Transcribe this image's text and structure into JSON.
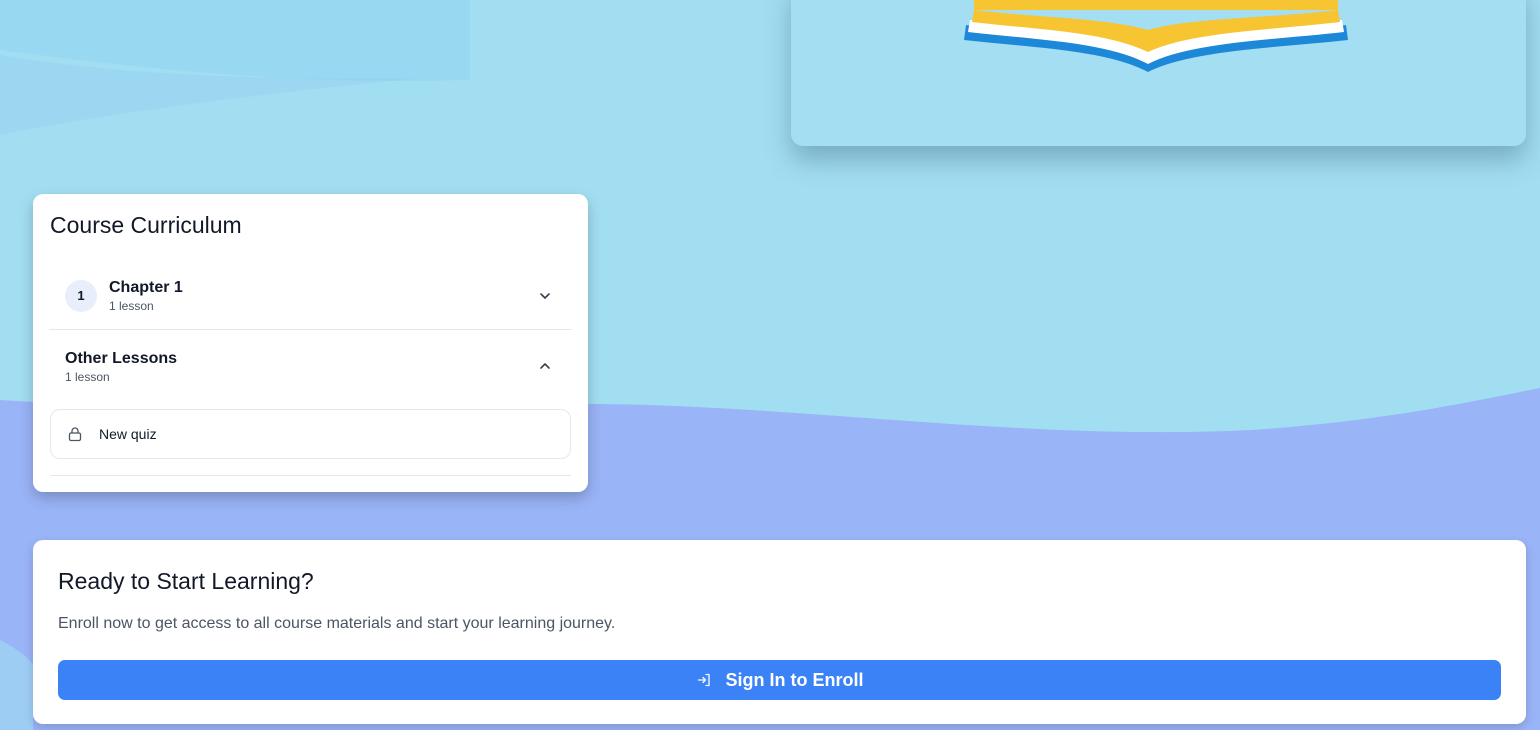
{
  "colors": {
    "sky": "#a2def2",
    "wave": "#9ab4f8",
    "primary": "#3b82f6",
    "card": "#ffffff"
  },
  "hero": {
    "image_icon": "book-logo-illustration"
  },
  "curriculum": {
    "title": "Course Curriculum",
    "sections": [
      {
        "number": "1",
        "name": "Chapter 1",
        "count": "1 lesson",
        "expanded": false,
        "icon": "chevron-down-icon"
      },
      {
        "number": "",
        "name": "Other Lessons",
        "count": "1 lesson",
        "expanded": true,
        "icon": "chevron-up-icon"
      }
    ],
    "lessons": [
      {
        "label": "New quiz",
        "icon": "lock-icon"
      }
    ]
  },
  "enroll": {
    "title": "Ready to Start Learning?",
    "description": "Enroll now to get access to all course materials and start your learning journey.",
    "button_label": "Sign In to Enroll",
    "button_icon": "sign-in-icon"
  }
}
